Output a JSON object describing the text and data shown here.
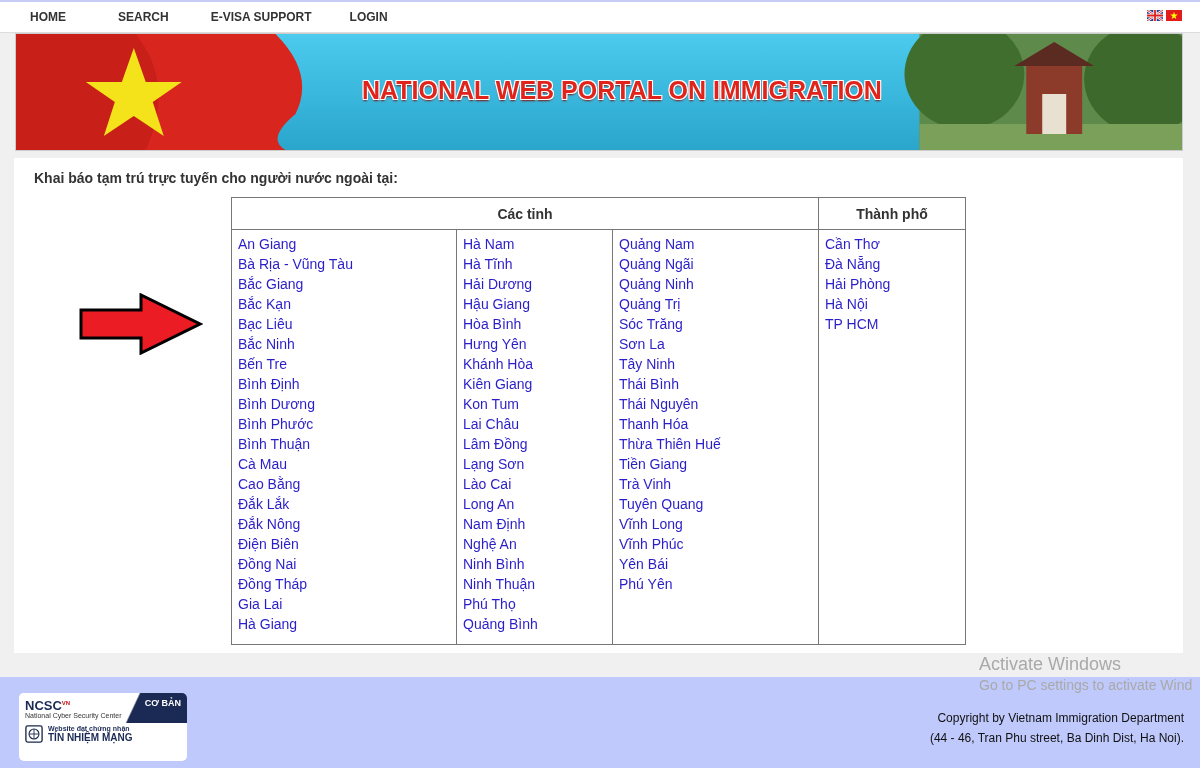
{
  "nav": {
    "items": [
      "HOME",
      "SEARCH",
      "E-VISA SUPPORT",
      "LOGIN"
    ]
  },
  "banner": {
    "title": "NATIONAL WEB PORTAL ON IMMIGRATION"
  },
  "heading": "Khai báo tạm trú trực tuyến cho người nước ngoài tại:",
  "table": {
    "headers": [
      {
        "label": "Các tỉnh"
      },
      {
        "label": "Thành phố"
      }
    ],
    "columns": [
      [
        "An Giang",
        "Bà Rịa - Vũng Tàu",
        "Bắc Giang",
        "Bắc Kạn",
        "Bạc Liêu",
        "Bắc Ninh",
        "Bến Tre",
        "Bình Định",
        "Bình Dương",
        "Bình Phước",
        "Bình Thuận",
        "Cà Mau",
        "Cao Bằng",
        "Đắk Lắk",
        "Đắk Nông",
        "Điện Biên",
        "Đồng Nai",
        "Đồng Tháp",
        "Gia Lai",
        "Hà Giang"
      ],
      [
        "Hà Nam",
        "Hà Tĩnh",
        "Hải Dương",
        "Hậu Giang",
        "Hòa Bình",
        "Hưng Yên",
        "Khánh Hòa",
        "Kiên Giang",
        "Kon Tum",
        "Lai Châu",
        "Lâm Đồng",
        "Lạng Sơn",
        "Lào Cai",
        "Long An",
        "Nam Định",
        "Nghệ An",
        "Ninh Bình",
        "Ninh Thuận",
        "Phú Thọ",
        "Quảng Bình"
      ],
      [
        "Quảng Nam",
        "Quảng Ngãi",
        "Quảng Ninh",
        "Quảng Trị",
        "Sóc Trăng",
        "Sơn La",
        "Tây Ninh",
        "Thái Bình",
        "Thái Nguyên",
        "Thanh Hóa",
        "Thừa Thiên Huế",
        "Tiền Giang",
        "Trà Vinh",
        "Tuyên Quang",
        "Vĩnh Long",
        "Vĩnh Phúc",
        "Yên Bái",
        "Phú Yên"
      ],
      [
        "Cần Thơ",
        "Đà Nẵng",
        "Hải Phòng",
        "Hà Nội",
        "TP HCM"
      ]
    ]
  },
  "footer": {
    "badge": {
      "brand": "NCSC",
      "brand_suffix": "VN",
      "brand_caption": "National Cyber Security Center",
      "level": "CƠ BẢN",
      "line_1": "Website đạt chứng nhận",
      "line_2": "TÍN NHIỆM MẠNG"
    },
    "copyright": [
      "Copyright by Vietnam Immigration Department",
      "(44 - 46, Tran Phu street, Ba Dinh Dist, Ha Noi)."
    ]
  },
  "os_overlay": {
    "title": "Activate Windows",
    "subtitle": "Go to PC settings to activate Wind"
  }
}
